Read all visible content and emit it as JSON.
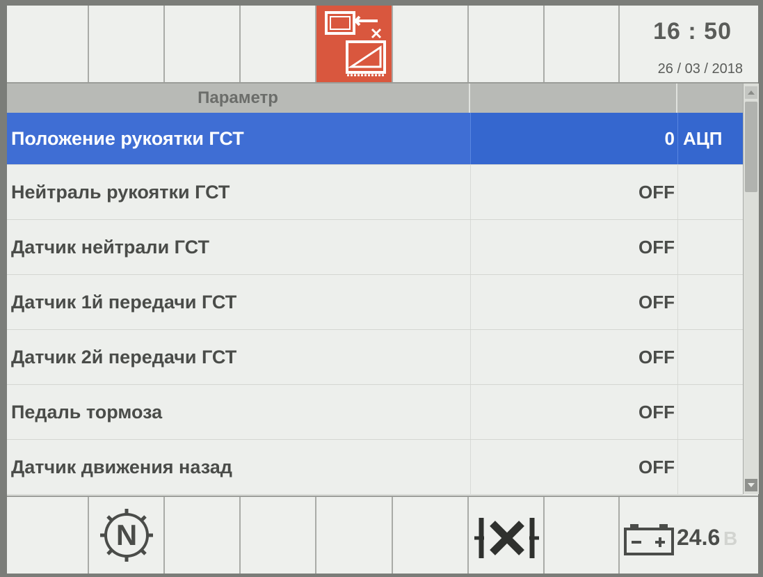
{
  "header": {
    "time": "16 : 50",
    "date": "26 / 03 / 2018",
    "mode_icon": "screen-swap-icon"
  },
  "table": {
    "columns": {
      "parameter": "Параметр",
      "value": "",
      "unit": ""
    },
    "selected_index": 0,
    "rows": [
      {
        "parameter": "Положение рукоятки ГСТ",
        "value": "0",
        "unit": "АЦП"
      },
      {
        "parameter": "Нейтраль рукоятки ГСТ",
        "value": "OFF",
        "unit": ""
      },
      {
        "parameter": "Датчик нейтрали ГСТ",
        "value": "OFF",
        "unit": ""
      },
      {
        "parameter": "Датчик 1й передачи ГСТ",
        "value": "OFF",
        "unit": ""
      },
      {
        "parameter": "Датчик 2й передачи ГСТ",
        "value": "OFF",
        "unit": ""
      },
      {
        "parameter": "Педаль тормоза",
        "value": "OFF",
        "unit": ""
      },
      {
        "parameter": "Датчик движения назад",
        "value": "OFF",
        "unit": ""
      }
    ]
  },
  "footer": {
    "gear_indicator": "N",
    "gear_icon": "neutral-gear-icon",
    "diff_lock_icon": "diff-lock-icon",
    "battery_icon": "battery-icon",
    "voltage": "24.6",
    "voltage_unit": "В"
  },
  "colors": {
    "selection": "#3f6ed4",
    "mode_button": "#d9573e",
    "text": "#4a4c49"
  }
}
